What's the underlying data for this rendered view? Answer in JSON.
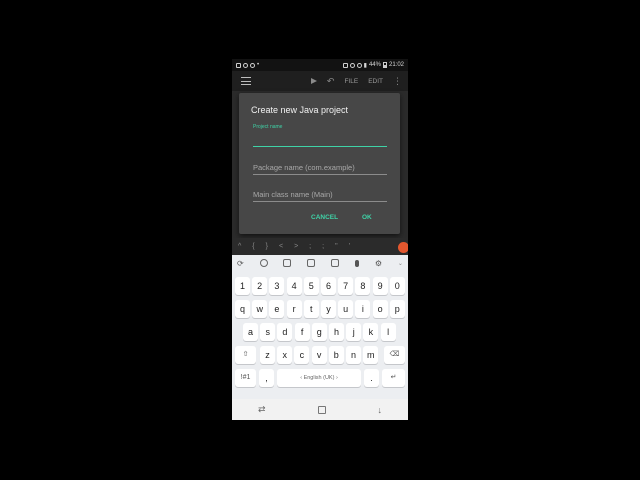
{
  "status_bar": {
    "battery": "44%",
    "time": "21:02"
  },
  "app_bar": {
    "file_label": "FILE",
    "edit_label": "EDIT",
    "more_label": "⋮"
  },
  "dialog": {
    "title": "Create new Java project",
    "project_name_label": "Project name",
    "package_placeholder": "Package name (com.example)",
    "main_class_placeholder": "Main class name (Main)",
    "cancel_label": "CANCEL",
    "ok_label": "OK"
  },
  "symbols": [
    "^",
    "{",
    "}",
    "<",
    ">",
    ";",
    ";",
    "\"",
    "'"
  ],
  "keyboard": {
    "row_numbers": [
      "1",
      "2",
      "3",
      "4",
      "5",
      "6",
      "7",
      "8",
      "9",
      "0"
    ],
    "row_q": [
      "q",
      "w",
      "e",
      "r",
      "t",
      "y",
      "u",
      "i",
      "o",
      "p"
    ],
    "row_a": [
      "a",
      "s",
      "d",
      "f",
      "g",
      "h",
      "j",
      "k",
      "l"
    ],
    "row_z": [
      "z",
      "x",
      "c",
      "v",
      "b",
      "n",
      "m"
    ],
    "symbols_key": "!#1",
    "comma_key": ",",
    "space_label": "‹ English (UK) ›",
    "period_key": "."
  },
  "colors": {
    "accent": "#3fd3a7",
    "dialog_bg": "#474747",
    "keyboard_bg": "#eceef1"
  }
}
